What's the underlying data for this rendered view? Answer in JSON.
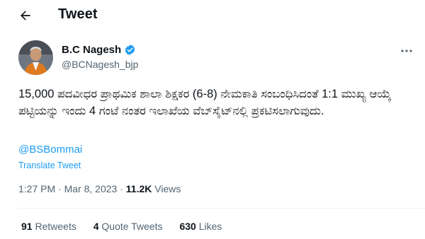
{
  "header": {
    "title": "Tweet",
    "back_icon": "back-arrow-icon"
  },
  "author": {
    "name": "B.C Nagesh",
    "handle": "@BCNagesh_bjp",
    "verified_color": "#1d9bf0"
  },
  "tweet": {
    "text": "15,000 ಪದವೀಧರ ಪ್ರಾಥಮಿಕ ಶಾಲಾ ಶಿಕ್ಷಕರ (6-8) ನೇಮಕಾತಿ ಸಂಬಂಧಿಸಿದಂತೆ 1:1 ಮುಖ್ಯ ಆಯ್ಕೆ ಪಟ್ಟಿಯನ್ನು ಇಂದು 4 ಗಂಟೆ ನಂತರ ಇಲಾಖೆಯ ವೆಬ್‌ಸೈಟ್‌ನಲ್ಲಿ ಪ್ರಕಟಿಸಲಾಗುವುದು.",
    "mention": "@BSBommai",
    "translate_label": "Translate Tweet",
    "time": "1:27 PM",
    "separator": "·",
    "date": "Mar 8, 2023",
    "views_count": "11.2K",
    "views_label": "Views"
  },
  "stats": {
    "retweets_count": "91",
    "retweets_label": "Retweets",
    "quotes_count": "4",
    "quotes_label": "Quote Tweets",
    "likes_count": "630",
    "likes_label": "Likes"
  },
  "colors": {
    "accent": "#1d9bf0",
    "text": "#0f1419",
    "muted": "#536471"
  }
}
